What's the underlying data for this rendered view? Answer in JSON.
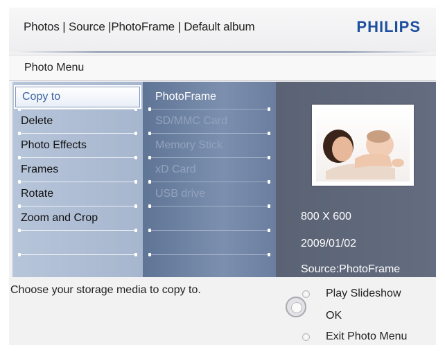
{
  "header": {
    "breadcrumb": "Photos | Source |PhotoFrame | Default album",
    "logo": "PHILIPS"
  },
  "menu": {
    "title": "Photo Menu",
    "items": [
      {
        "label": "Copy to",
        "selected": true
      },
      {
        "label": "Delete"
      },
      {
        "label": "Photo Effects"
      },
      {
        "label": "Frames"
      },
      {
        "label": "Rotate"
      },
      {
        "label": "Zoom and Crop"
      }
    ]
  },
  "submenu": {
    "items": [
      {
        "label": "PhotoFrame",
        "enabled": true
      },
      {
        "label": "SD/MMC Card",
        "enabled": false
      },
      {
        "label": "Memory Stick",
        "enabled": false
      },
      {
        "label": "xD Card",
        "enabled": false
      },
      {
        "label": "USB drive",
        "enabled": false
      }
    ]
  },
  "photo": {
    "resolution": "800 X 600",
    "date": "2009/01/02",
    "source": "Source:PhotoFrame"
  },
  "footer": {
    "help": "Choose your storage media to copy to.",
    "options": {
      "play": "Play Slideshow",
      "ok": "OK",
      "exit": "Exit Photo Menu"
    }
  },
  "colors": {
    "accent": "#3e64a3",
    "logo": "#1c4f9e",
    "panel": "#5d6577"
  }
}
